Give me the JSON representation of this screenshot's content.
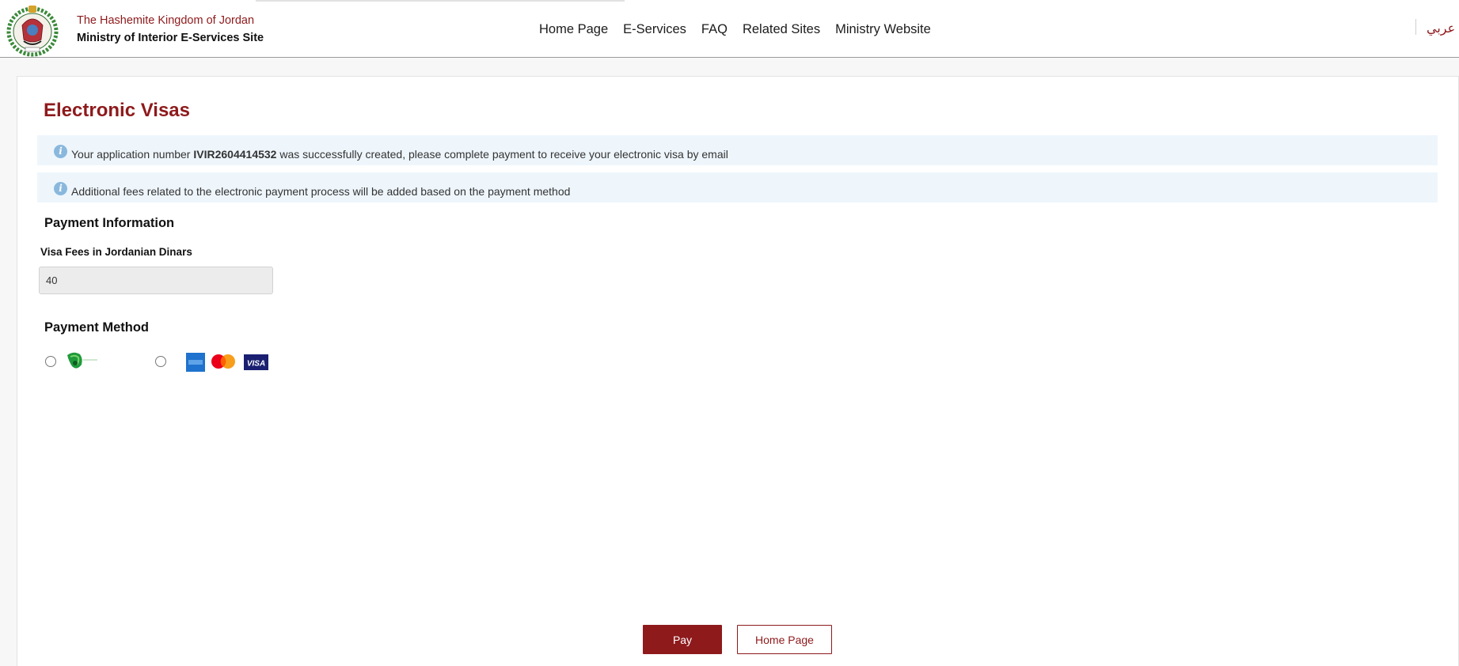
{
  "header": {
    "kingdom": "The Hashemite Kingdom of Jordan",
    "site_name": "Ministry of Interior E-Services Site",
    "nav": [
      "Home Page",
      "E-Services",
      "FAQ",
      "Related Sites",
      "Ministry Website"
    ],
    "language_toggle": "عربي",
    "emblem_icon": "jordan-coat-of-arms"
  },
  "main": {
    "title": "Electronic Visas",
    "alerts": [
      {
        "icon": "info-icon",
        "before": "Your application number ",
        "application_number": "IVIR2604414532",
        "after": " was successfully created, please complete payment to receive your electronic visa by email"
      },
      {
        "icon": "info-icon",
        "text": "Additional fees related to the electronic payment process will be added based on the payment method"
      }
    ],
    "payment_information": {
      "title": "Payment Information",
      "fee_label": "Visa Fees in Jordanian Dinars",
      "fee_value": "40"
    },
    "payment_method": {
      "title": "Payment Method",
      "options": [
        {
          "icon": "efawateercom-logo",
          "selected": false
        },
        {
          "icon": "amex-mastercard-visa-logos",
          "selected": false
        }
      ]
    },
    "buttons": {
      "pay": "Pay",
      "home": "Home Page"
    }
  },
  "colors": {
    "brand": "#8e1a1c",
    "alert_bg": "#eef6fc",
    "info_icon": "#8ab8dd"
  }
}
